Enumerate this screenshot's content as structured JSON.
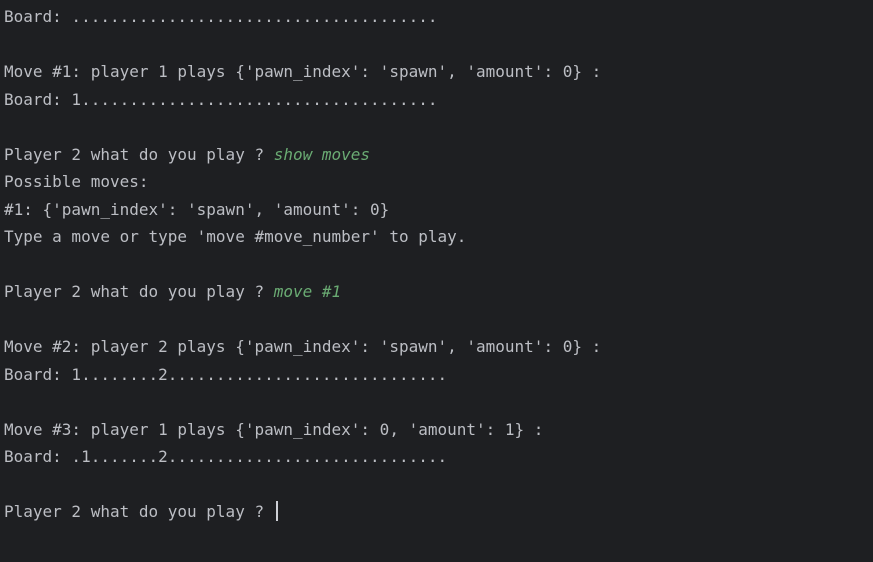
{
  "console": {
    "lines": [
      {
        "text": "Board: ......................................"
      },
      {
        "text": ""
      },
      {
        "text": "Move #1: player 1 plays {'pawn_index': 'spawn', 'amount': 0} :"
      },
      {
        "text": "Board: 1....................................."
      },
      {
        "text": ""
      },
      {
        "text": "Player 2 what do you play ? ",
        "input": "show moves"
      },
      {
        "text": "Possible moves:"
      },
      {
        "text": "#1: {'pawn_index': 'spawn', 'amount': 0}"
      },
      {
        "text": "Type a move or type 'move #move_number' to play."
      },
      {
        "text": ""
      },
      {
        "text": "Player 2 what do you play ? ",
        "input": "move #1"
      },
      {
        "text": ""
      },
      {
        "text": "Move #2: player 2 plays {'pawn_index': 'spawn', 'amount': 0} :"
      },
      {
        "text": "Board: 1........2............................."
      },
      {
        "text": ""
      },
      {
        "text": "Move #3: player 1 plays {'pawn_index': 0, 'amount': 1} :"
      },
      {
        "text": "Board: .1.......2............................."
      },
      {
        "text": ""
      },
      {
        "text": "Player 2 what do you play ? "
      }
    ],
    "colors": {
      "background": "#1e1f22",
      "output_text": "#bcbec4",
      "user_input": "#6aab73",
      "caret": "#ced0d6"
    }
  }
}
